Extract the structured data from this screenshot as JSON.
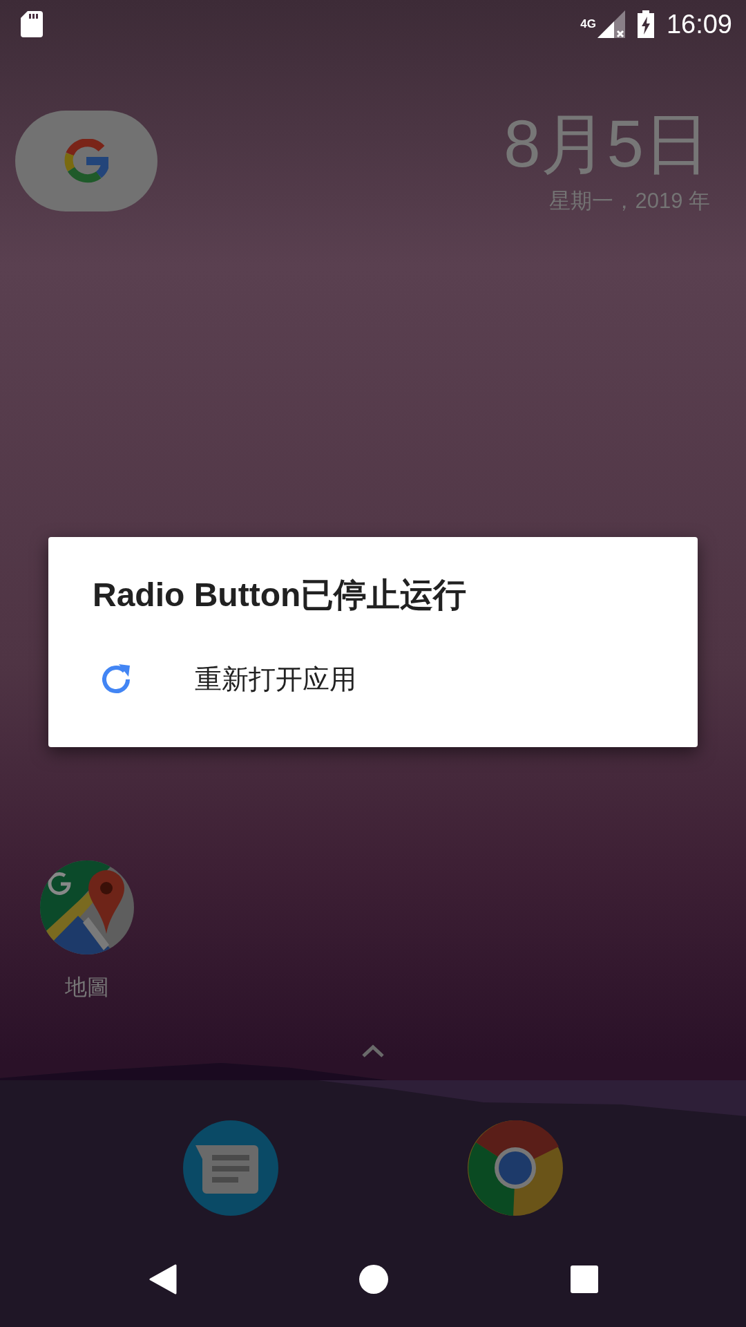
{
  "status_bar": {
    "network": "4G",
    "time": "16:09"
  },
  "date_widget": {
    "date": "8月5日",
    "weekday_year": "星期一，2019 年"
  },
  "dialog": {
    "title": "Radio Button已停止运行",
    "options": [
      {
        "label": "重新打开应用"
      }
    ]
  },
  "home_apps": [
    {
      "label": "地圖"
    }
  ]
}
